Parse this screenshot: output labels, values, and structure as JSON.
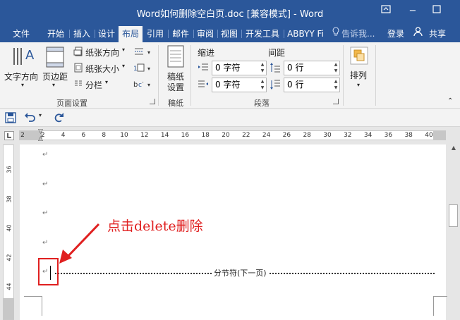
{
  "window": {
    "title": "Word如何删除空白页.doc [兼容模式] - Word",
    "restore_icon": "ribbon-display-options-icon",
    "minimize": "−",
    "maximize": "☐"
  },
  "tabs": {
    "file": "文件",
    "home": "开始",
    "insert": "插入",
    "design": "设计",
    "layout": "布局",
    "references": "引用",
    "mailings": "邮件",
    "review": "审阅",
    "view": "视图",
    "developer": "开发工具",
    "abbyy": "ABBYY Fi",
    "tell_me": "告诉我...",
    "signin": "登录",
    "share": "共享"
  },
  "ribbon": {
    "page_setup": {
      "text_direction": "文字方向",
      "margins": "页边距",
      "orientation": "纸张方向",
      "size": "纸张大小",
      "columns": "分栏",
      "group_label": "页面设置"
    },
    "manuscript": {
      "manuscript_settings_line1": "稿纸",
      "manuscript_settings_line2": "设置",
      "group_label": "稿纸"
    },
    "paragraph": {
      "indent_label": "缩进",
      "spacing_label": "间距",
      "indent_left": "0 字符",
      "indent_right": "0 字符",
      "spacing_before": "0 行",
      "spacing_after": "0 行",
      "group_label": "段落"
    },
    "arrange": {
      "label": "排列"
    }
  },
  "ruler": {
    "h_ticks": [
      "2",
      "2",
      "4",
      "6",
      "8",
      "10",
      "12",
      "14",
      "16",
      "18",
      "20",
      "22",
      "24",
      "26",
      "28",
      "30",
      "32",
      "34",
      "36",
      "38",
      "40"
    ],
    "v_ticks": [
      "36",
      "38",
      "40",
      "42",
      "44"
    ]
  },
  "document": {
    "section_break_label": "分节符(下一页)",
    "annotation": "点击delete删除",
    "paragraph_mark": "↵"
  },
  "colors": {
    "brand": "#2b579a",
    "annotation": "#e02020"
  }
}
